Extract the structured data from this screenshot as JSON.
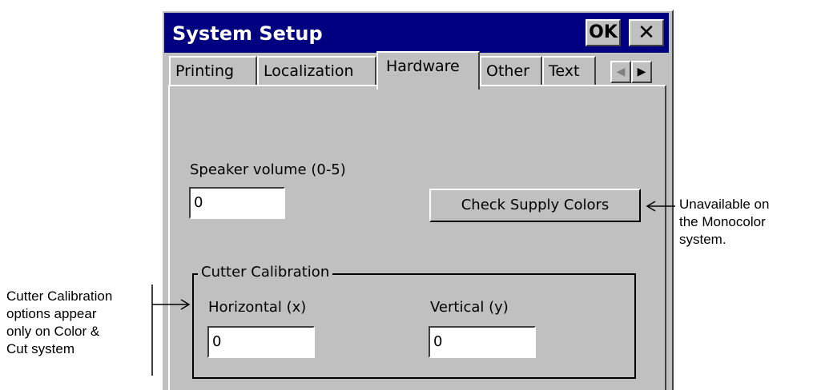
{
  "window": {
    "title": "System Setup",
    "ok_label": "OK",
    "close_label": "✕"
  },
  "tabs": [
    {
      "label": "Printing",
      "active": false
    },
    {
      "label": "Localization",
      "active": false
    },
    {
      "label": "Hardware",
      "active": true
    },
    {
      "label": "Other",
      "active": false
    },
    {
      "label": "Text",
      "active": false
    }
  ],
  "tab_scroll": {
    "left": "◀",
    "right": "▶"
  },
  "hardware": {
    "speaker_label": "Speaker volume (0-5)",
    "speaker_value": "0",
    "check_supply_label": "Check Supply Colors",
    "cutter": {
      "legend": "Cutter Calibration",
      "horizontal_label": "Horizontal (x)",
      "horizontal_value": "0",
      "vertical_label": "Vertical (y)",
      "vertical_value": "0"
    }
  },
  "annotations": {
    "right_note": [
      "Unavailable on",
      "the Monocolor",
      "system."
    ],
    "left_note": [
      "Cutter Calibration",
      "options appear",
      "only on Color &",
      "Cut system"
    ]
  }
}
